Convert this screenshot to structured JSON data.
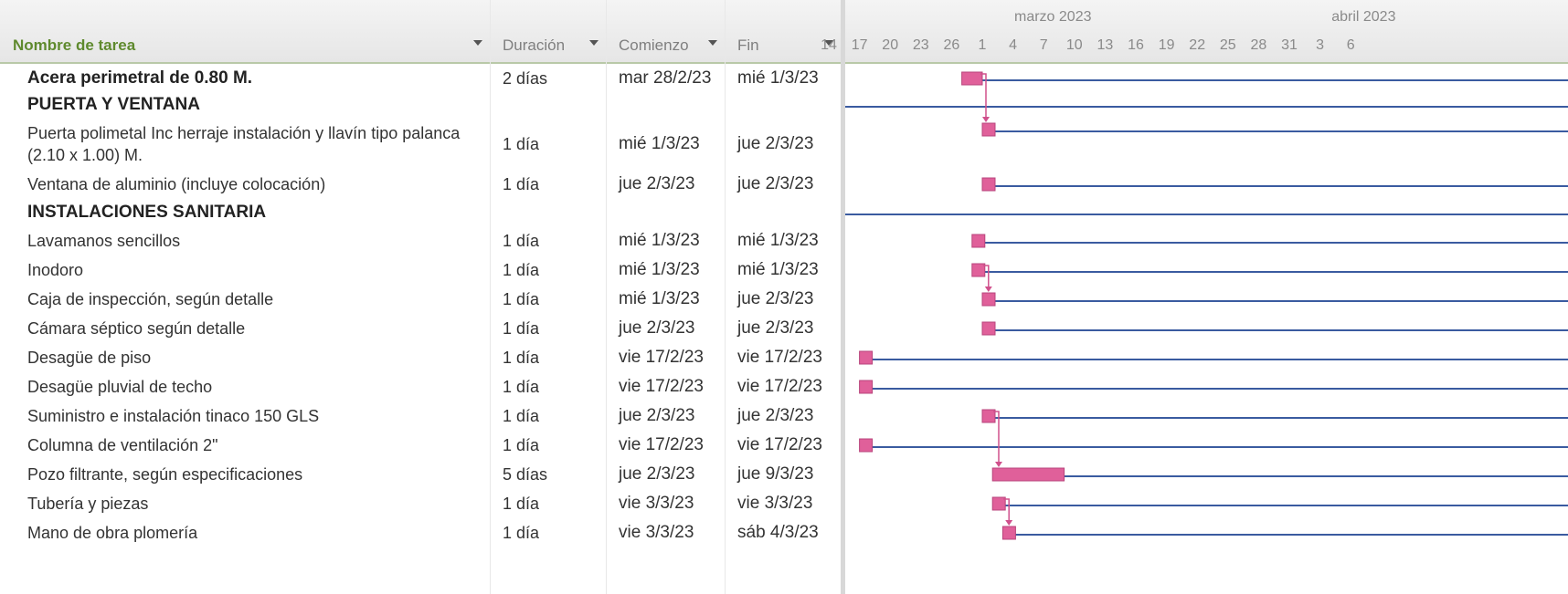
{
  "columns": {
    "name": "Nombre de tarea",
    "duration": "Duración",
    "start": "Comienzo",
    "end": "Fin"
  },
  "timeline": {
    "months": [
      {
        "label": "marzo 2023",
        "day": 0
      },
      {
        "label": "abril 2023",
        "day": 31
      }
    ],
    "day_ticks": [
      {
        "label": "14",
        "day": -15
      },
      {
        "label": "17",
        "day": -12
      },
      {
        "label": "20",
        "day": -9
      },
      {
        "label": "23",
        "day": -6
      },
      {
        "label": "26",
        "day": -3
      },
      {
        "label": "1",
        "day": 0
      },
      {
        "label": "4",
        "day": 3
      },
      {
        "label": "7",
        "day": 6
      },
      {
        "label": "10",
        "day": 9
      },
      {
        "label": "13",
        "day": 12
      },
      {
        "label": "16",
        "day": 15
      },
      {
        "label": "19",
        "day": 18
      },
      {
        "label": "22",
        "day": 21
      },
      {
        "label": "25",
        "day": 24
      },
      {
        "label": "28",
        "day": 27
      },
      {
        "label": "31",
        "day": 30
      },
      {
        "label": "3",
        "day": 33
      },
      {
        "label": "6",
        "day": 36
      }
    ]
  },
  "tasks": [
    {
      "name": "Acera perimetral de 0.80 M.",
      "duration": "2 días",
      "start": "mar 28/2/23",
      "end": "mié 1/3/23",
      "style": "bold",
      "bar_start": -2,
      "bar_days": 2
    },
    {
      "name": "PUERTA Y VENTANA",
      "duration": "",
      "start": "",
      "end": "",
      "style": "summary"
    },
    {
      "name": "Puerta polimetal Inc herraje instalación y llavín tipo palanca (2.10 x 1.00) M.",
      "duration": "1 día",
      "start": "mié 1/3/23",
      "end": "jue 2/3/23",
      "style": "normal",
      "bar_start": 0,
      "bar_days": 1
    },
    {
      "name": "Ventana de aluminio (incluye colocación)",
      "duration": "1 día",
      "start": "jue 2/3/23",
      "end": "jue 2/3/23",
      "style": "normal",
      "bar_start": 0,
      "bar_days": 1
    },
    {
      "name": "INSTALACIONES SANITARIA",
      "duration": "",
      "start": "",
      "end": "",
      "style": "summary"
    },
    {
      "name": "Lavamanos sencillos",
      "duration": "1 día",
      "start": "mié 1/3/23",
      "end": "mié 1/3/23",
      "style": "normal",
      "bar_start": -1,
      "bar_days": 1
    },
    {
      "name": "Inodoro",
      "duration": "1 día",
      "start": "mié 1/3/23",
      "end": "mié 1/3/23",
      "style": "normal",
      "bar_start": -1,
      "bar_days": 1
    },
    {
      "name": "Caja de inspección, según detalle",
      "duration": "1 día",
      "start": "mié 1/3/23",
      "end": "jue 2/3/23",
      "style": "normal",
      "bar_start": 0,
      "bar_days": 1
    },
    {
      "name": "Cámara séptico según detalle",
      "duration": "1 día",
      "start": "jue 2/3/23",
      "end": "jue 2/3/23",
      "style": "normal",
      "bar_start": 0,
      "bar_days": 1
    },
    {
      "name": "Desagüe de piso",
      "duration": "1 día",
      "start": "vie 17/2/23",
      "end": "vie 17/2/23",
      "style": "normal",
      "bar_start": -12,
      "bar_days": 1
    },
    {
      "name": "Desagüe pluvial de techo",
      "duration": "1 día",
      "start": "vie 17/2/23",
      "end": "vie 17/2/23",
      "style": "normal",
      "bar_start": -12,
      "bar_days": 1
    },
    {
      "name": "Suministro e instalación tinaco 150 GLS",
      "duration": "1 día",
      "start": "jue 2/3/23",
      "end": "jue 2/3/23",
      "style": "normal",
      "bar_start": 0,
      "bar_days": 1
    },
    {
      "name": "Columna de ventilación 2\"",
      "duration": "1 día",
      "start": "vie 17/2/23",
      "end": "vie 17/2/23",
      "style": "normal",
      "bar_start": -12,
      "bar_days": 1
    },
    {
      "name": "Pozo filtrante, según especificaciones",
      "duration": "5 días",
      "start": "jue 2/3/23",
      "end": "jue 9/3/23",
      "style": "normal",
      "bar_start": 1,
      "bar_days": 7
    },
    {
      "name": "Tubería y piezas",
      "duration": "1 día",
      "start": "vie 3/3/23",
      "end": "vie 3/3/23",
      "style": "normal",
      "bar_start": 1,
      "bar_days": 1
    },
    {
      "name": "Mano de obra plomería",
      "duration": "1 día",
      "start": "vie 3/3/23",
      "end": "sáb 4/3/23",
      "style": "normal",
      "bar_start": 2,
      "bar_days": 1
    }
  ],
  "links": [
    {
      "from": 0,
      "to": 2
    },
    {
      "from": 6,
      "to": 7
    },
    {
      "from": 11,
      "to": 13
    },
    {
      "from": 14,
      "to": 15
    }
  ],
  "colors": {
    "bar": "#e0609a",
    "bar_edge": "#b8457c",
    "line": "#3a5ba0",
    "link": "#d0508c"
  }
}
